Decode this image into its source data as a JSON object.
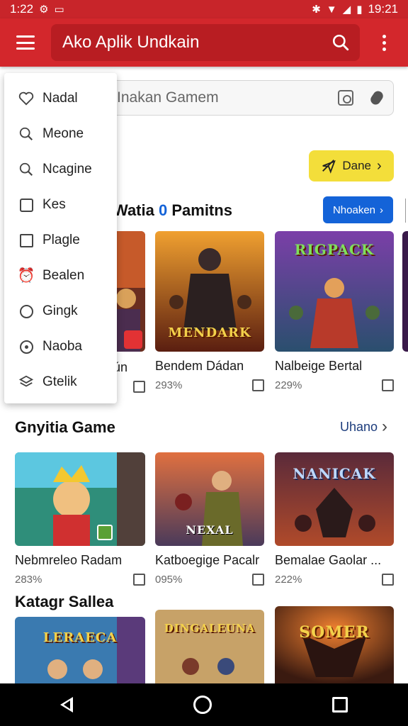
{
  "status_bar": {
    "time_left": "1:22",
    "time_right": "19:21"
  },
  "app_bar": {
    "title": "Ako Aplik Undkain"
  },
  "search": {
    "placeholder": "Inakan Gamem"
  },
  "action_button": {
    "label": "Dane"
  },
  "drawer": {
    "items": [
      {
        "label": "Nadal",
        "icon": "heart-icon"
      },
      {
        "label": "Meone",
        "icon": "search-icon"
      },
      {
        "label": "Ncagine",
        "icon": "search-icon"
      },
      {
        "label": "Kes",
        "icon": "tablet-icon"
      },
      {
        "label": "Plagle",
        "icon": "square-icon"
      },
      {
        "label": "Bealen",
        "icon": "alarm-icon"
      },
      {
        "label": "Gingk",
        "icon": "compass-icon"
      },
      {
        "label": "Naoba",
        "icon": "radio-icon"
      },
      {
        "label": "Gtelik",
        "icon": "layers-icon"
      }
    ]
  },
  "section1": {
    "title_prefix": "Watia ",
    "title_highlight": "0",
    "title_suffix": " Pamitns",
    "button_label": "Nhoaken",
    "cards": [
      {
        "title": "hún",
        "meta": ""
      },
      {
        "title": "Bendem Dádan",
        "meta": "293%",
        "art": "MENDARK"
      },
      {
        "title": "Nalbeige Bertal",
        "meta": "229%",
        "art": "RIGPACK"
      }
    ]
  },
  "section2": {
    "title": "Gnyitia Game",
    "see_all": "Uhano",
    "cards": [
      {
        "title": "Nebmreleo Radam",
        "meta": "283%"
      },
      {
        "title": "Katboegige Pacalr",
        "meta": "095%",
        "art": "NEXAL"
      },
      {
        "title": "Bemalae Gaolar ...",
        "meta": "222%",
        "art": "NANICAK"
      }
    ]
  },
  "section3": {
    "title": "Katagr Sallea",
    "cards": [
      {
        "art": "LERAECA"
      },
      {
        "art": "DINGALEUNA"
      },
      {
        "art": "SOMER"
      }
    ]
  },
  "colors": {
    "brand_red": "#d3272c",
    "accent_blue": "#1463d8",
    "accent_yellow": "#f3de3a"
  }
}
